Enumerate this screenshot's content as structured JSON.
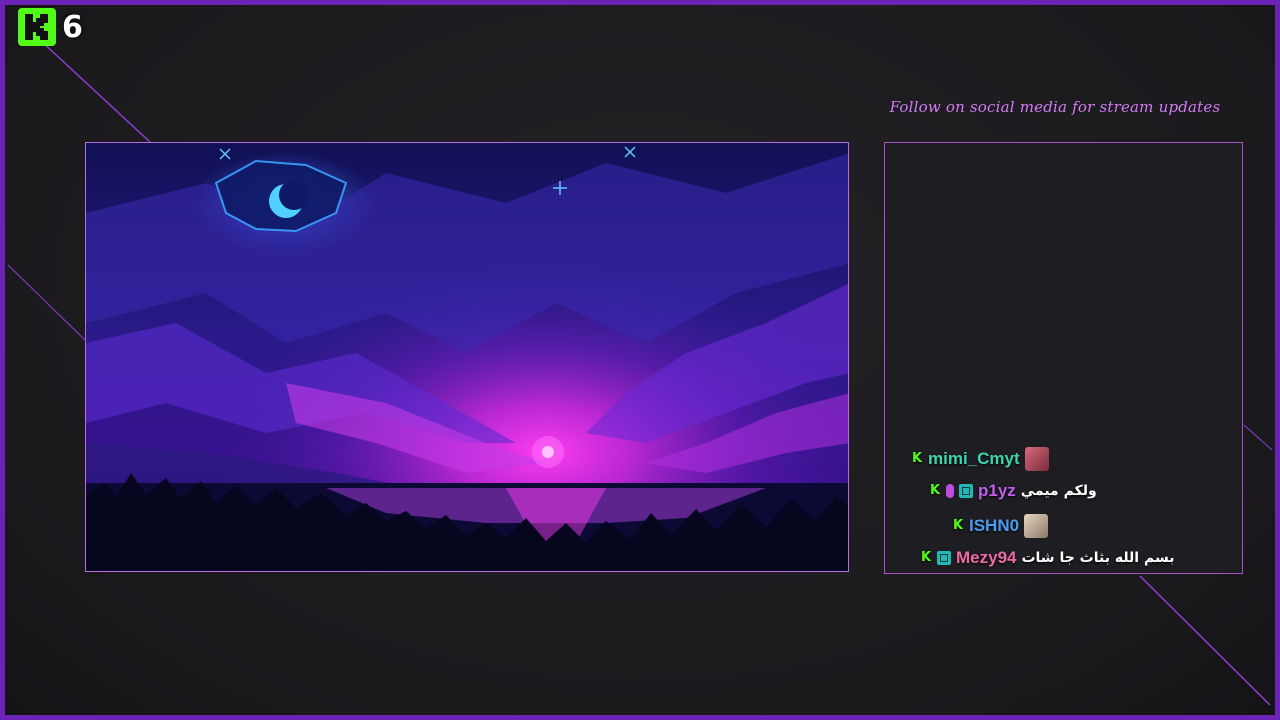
{
  "overlay": {
    "viewer_count": "6",
    "social_text": "Follow on social media for stream updates"
  },
  "colors": {
    "frame": "#6a23b5",
    "kick_green": "#53fc18",
    "accent_pink": "#d37cf3"
  },
  "chat": {
    "messages": [
      {
        "username": "mimi_Cmyt",
        "user_color": "#3fd4b0",
        "message": "",
        "badges": [
          "kick"
        ],
        "avatar": "pink-avatar"
      },
      {
        "username": "p1yz",
        "user_color": "#c05ff0",
        "message": "ولكم ميمي",
        "badges": [
          "kick",
          "mic",
          "og"
        ],
        "avatar": ""
      },
      {
        "username": "ISHN0",
        "user_color": "#4c9bf0",
        "message": "",
        "badges": [
          "kick"
        ],
        "avatar": "beige-avatar"
      },
      {
        "username": "Mezy94",
        "user_color": "#f06aa6",
        "message": "بسم الله بثاث جا شات",
        "badges": [
          "kick",
          "og"
        ],
        "avatar": ""
      }
    ]
  },
  "icons": {
    "logo": "kick-logo-icon",
    "mic_badge": "mic-badge-icon",
    "og_badge": "og-badge-icon"
  }
}
